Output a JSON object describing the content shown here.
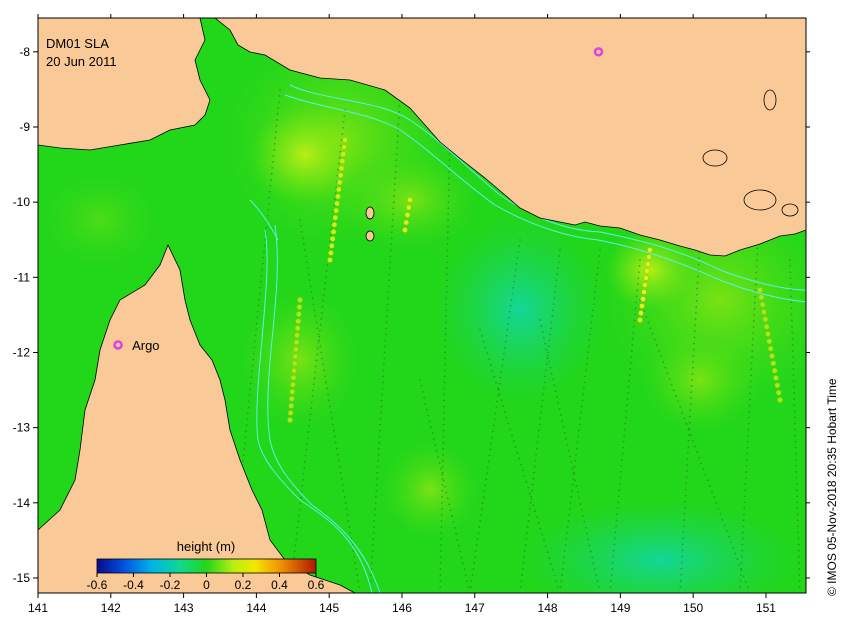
{
  "map": {
    "title": "DM01 SLA",
    "date": "20 Jun 2011",
    "x_ticks": [
      "141",
      "142",
      "143",
      "144",
      "145",
      "146",
      "147",
      "148",
      "149",
      "150",
      "151"
    ],
    "y_ticks": [
      "-8",
      "-9",
      "-10",
      "-11",
      "-12",
      "-13",
      "-14",
      "-15"
    ],
    "land_color": "#f9c998",
    "sea_base_color": "#22d61a",
    "contour_color": "#5cf0e6"
  },
  "markers": [
    {
      "label": "Argo",
      "lon": 142.1,
      "lat": -11.9,
      "color": "#e040e0"
    },
    {
      "label": "",
      "lon": 148.7,
      "lat": -8.0,
      "color": "#e040e0"
    }
  ],
  "colorbar": {
    "title": "height (m)",
    "ticks": [
      "-0.6",
      "-0.4",
      "-0.2",
      "0",
      "0.2",
      "0.4",
      "0.6"
    ],
    "min": -0.6,
    "max": 0.6
  },
  "credit": "© IMOS 05-Nov-2018 20:35 Hobart Time"
}
